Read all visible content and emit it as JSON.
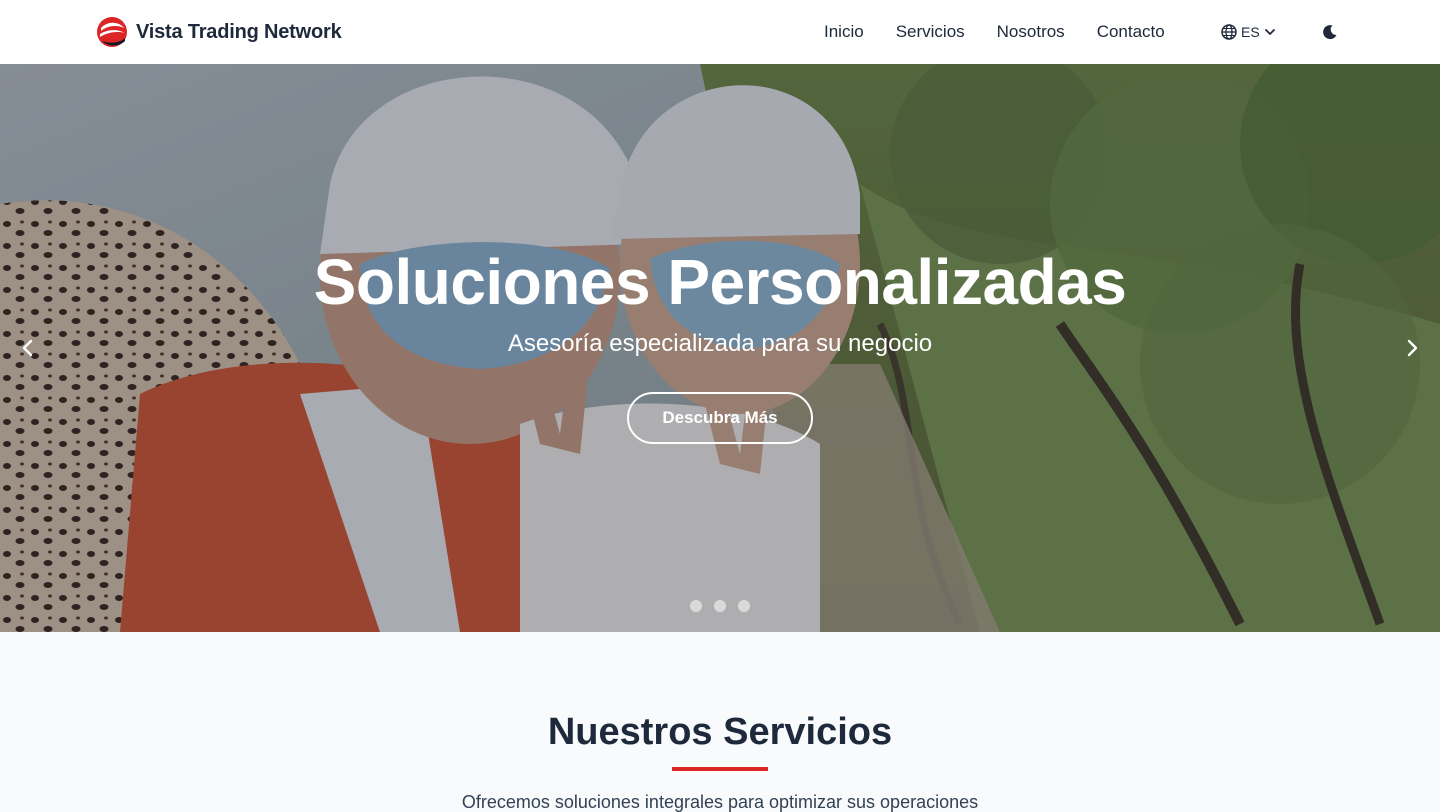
{
  "brand": {
    "name": "Vista Trading Network",
    "logo_icon": "globe-swoosh-logo",
    "accent": "#dc2626"
  },
  "nav": {
    "items": [
      {
        "label": "Inicio"
      },
      {
        "label": "Servicios"
      },
      {
        "label": "Nosotros"
      },
      {
        "label": "Contacto"
      }
    ]
  },
  "language": {
    "icon": "globe-icon",
    "selected": "ES",
    "chevron_icon": "chevron-down-icon"
  },
  "theme_toggle": {
    "icon": "moon-icon"
  },
  "hero": {
    "title": "Soluciones Personalizadas",
    "subtitle": "Asesoría especializada para su negocio",
    "cta_label": "Descubra Más",
    "prev_icon": "chevron-left-icon",
    "next_icon": "chevron-right-icon",
    "slide_count": 3
  },
  "services": {
    "title": "Nuestros Servicios",
    "subtitle": "Ofrecemos soluciones integrales para optimizar sus operaciones"
  }
}
